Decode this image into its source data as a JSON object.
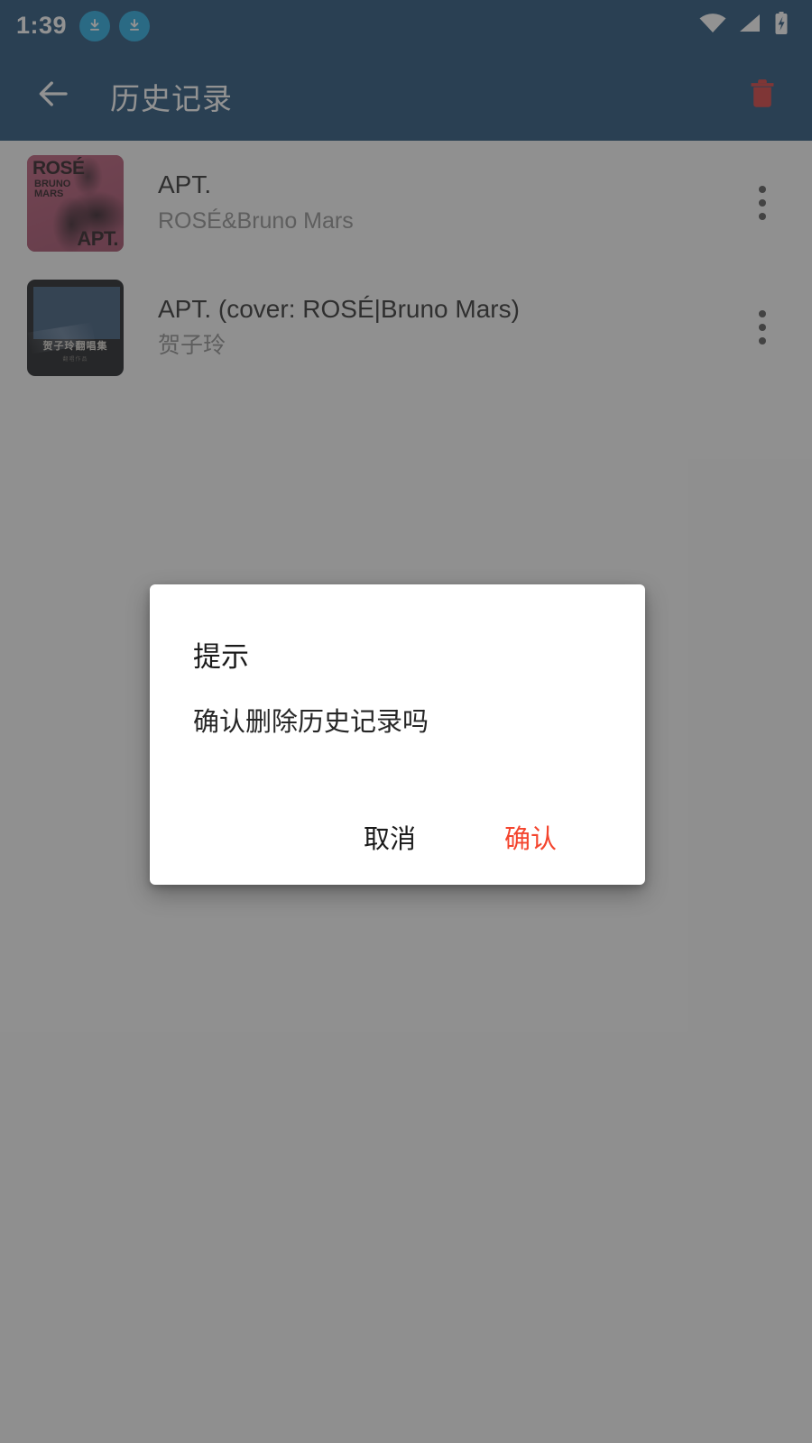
{
  "statusbar": {
    "time": "1:39",
    "icons": [
      "download-icon",
      "download-icon"
    ],
    "right_icons": [
      "wifi-icon",
      "cellular-signal-icon",
      "battery-charging-icon"
    ]
  },
  "appbar": {
    "back_label": "back-arrow",
    "title": "历史记录",
    "delete_label": "delete-all",
    "background_color": "#134671",
    "delete_icon_color": "#d32f2f"
  },
  "list": {
    "items": [
      {
        "title": "APT.",
        "subtitle": "ROSÉ&Bruno Mars",
        "cover": {
          "kind": "apt-album-art",
          "line1": "ROSÉ",
          "line2": "BRUNO\nMARS",
          "line3": "APT.",
          "color": "#b24a6a"
        },
        "menu_label": "more-options"
      },
      {
        "title": "APT. (cover: ROSÉ|Bruno Mars)",
        "subtitle": "贺子玲",
        "cover": {
          "kind": "hezilin-album-art",
          "line1": "贺子玲翻唱集",
          "line2": "翻唱作品",
          "color": "#0a0c10"
        },
        "menu_label": "more-options"
      }
    ]
  },
  "dialog": {
    "title": "提示",
    "message": "确认删除历史记录吗",
    "cancel_label": "取消",
    "confirm_label": "确认",
    "confirm_color": "#f4452e"
  },
  "colors": {
    "primary": "#134671",
    "scrim": "rgba(60,60,60,0.56)",
    "page_background": "#fafafa"
  }
}
